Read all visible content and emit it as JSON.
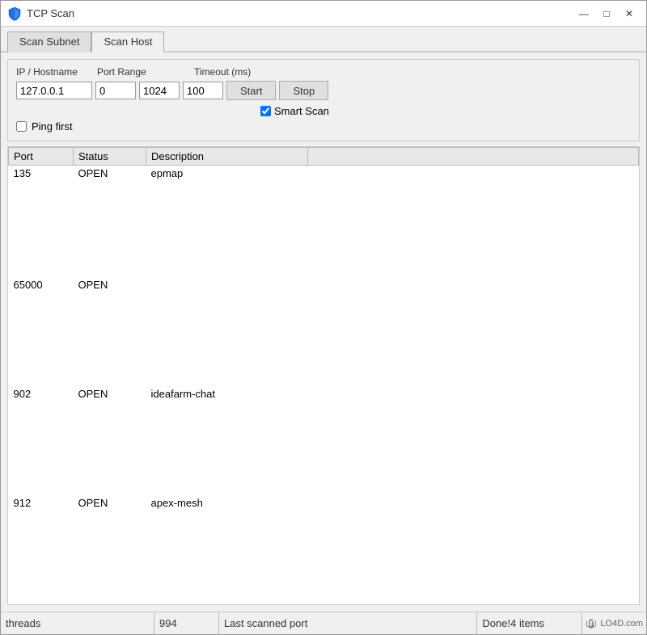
{
  "window": {
    "title": "TCP Scan",
    "icon": "shield"
  },
  "titlebar": {
    "minimize_label": "—",
    "maximize_label": "□",
    "close_label": "✕"
  },
  "tabs": [
    {
      "label": "Scan Subnet",
      "active": false
    },
    {
      "label": "Scan Host",
      "active": true
    }
  ],
  "form": {
    "ip_label": "IP / Hostname",
    "port_label": "Port Range",
    "timeout_label": "Timeout (ms)",
    "ip_value": "127.0.0.1",
    "port_start_value": "0",
    "port_end_value": "1024",
    "timeout_value": "100",
    "start_label": "Start",
    "stop_label": "Stop",
    "smart_scan_label": "Smart Scan",
    "smart_scan_checked": true,
    "ping_first_label": "Ping first",
    "ping_first_checked": false
  },
  "table": {
    "columns": [
      "Port",
      "Status",
      "Description",
      ""
    ],
    "rows": [
      {
        "port": "135",
        "status": "OPEN",
        "description": "epmap"
      },
      {
        "port": "65000",
        "status": "OPEN",
        "description": ""
      },
      {
        "port": "902",
        "status": "OPEN",
        "description": "ideafarm-chat"
      },
      {
        "port": "912",
        "status": "OPEN",
        "description": "apex-mesh"
      }
    ]
  },
  "statusbar": {
    "threads_label": "threads",
    "threads_value": "994",
    "last_port_label": "Last scanned port",
    "done_label": "Done!4 items"
  },
  "watermark": {
    "text": "LO4D.com"
  }
}
